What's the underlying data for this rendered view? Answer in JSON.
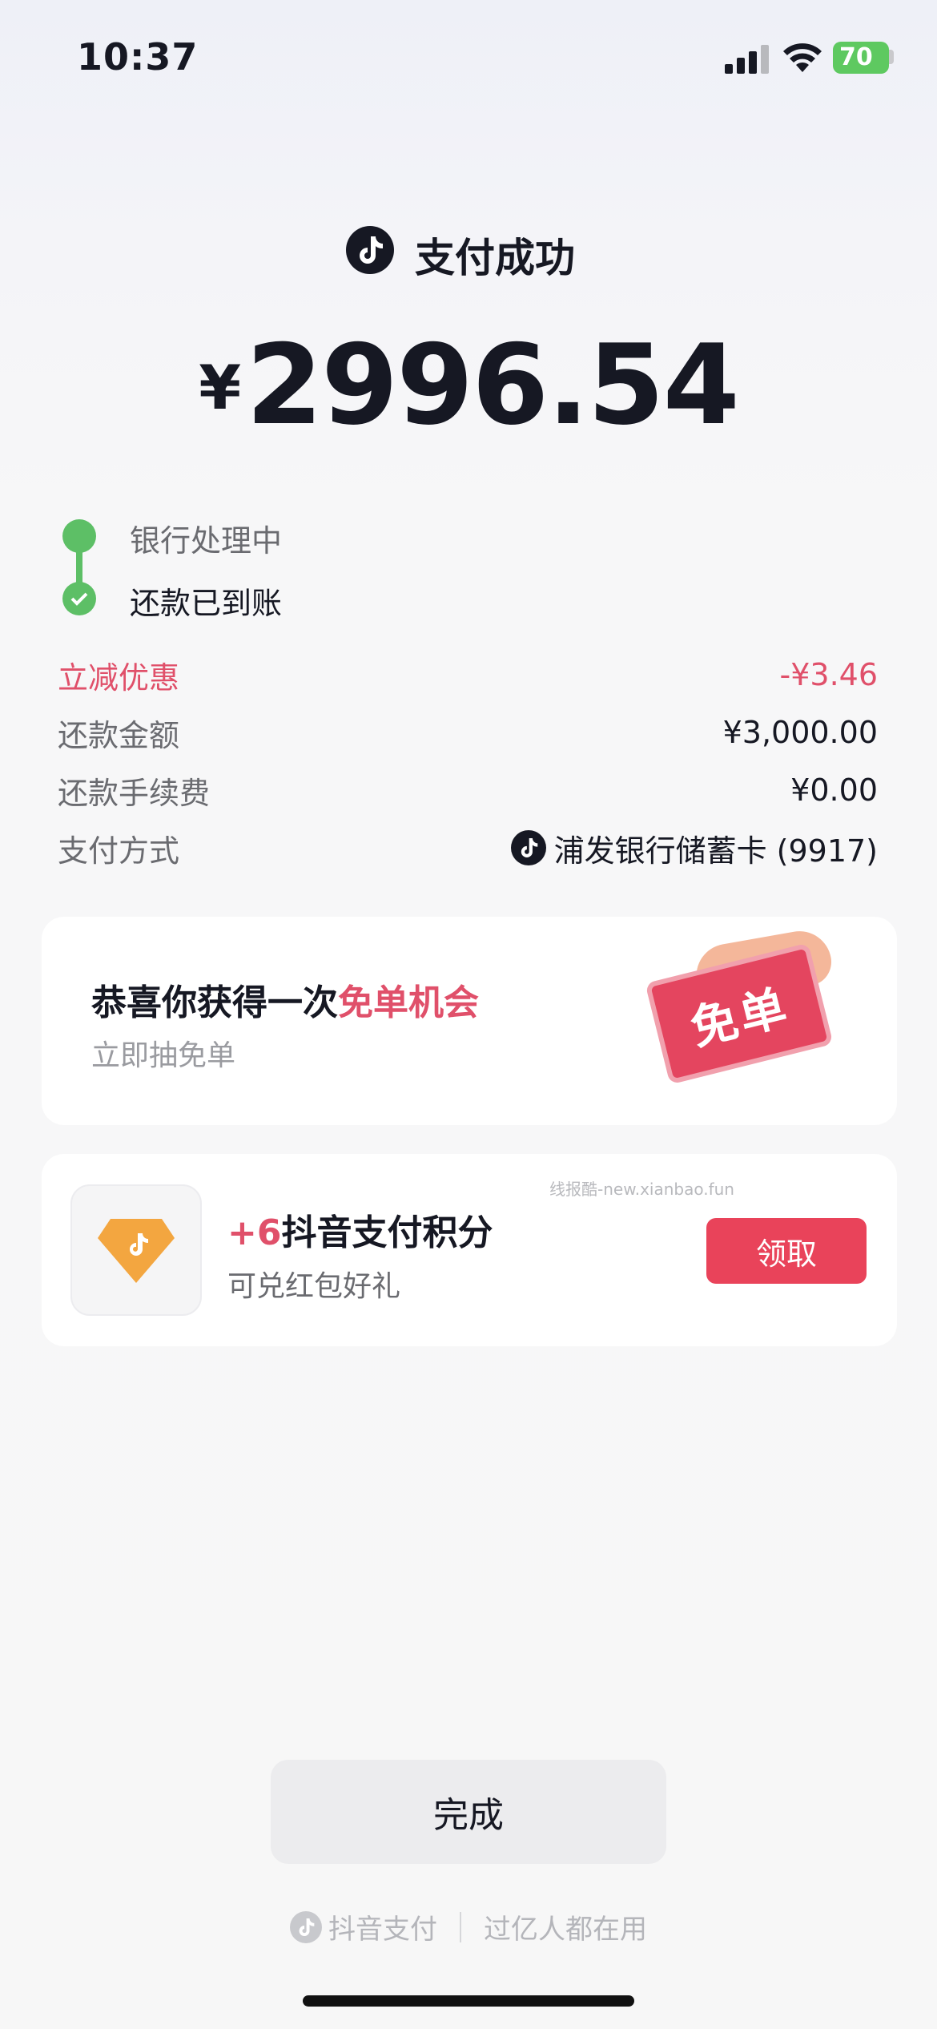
{
  "status_bar": {
    "time": "10:37",
    "battery": "70"
  },
  "header": {
    "title": "支付成功",
    "currency": "¥",
    "amount": "2996.54"
  },
  "progress": {
    "steps": [
      "银行处理中",
      "还款已到账"
    ]
  },
  "details": [
    {
      "label": "立减优惠",
      "value": "-¥3.46",
      "highlight": true
    },
    {
      "label": "还款金额",
      "value": "¥3,000.00"
    },
    {
      "label": "还款手续费",
      "value": "¥0.00"
    },
    {
      "label": "支付方式",
      "value": "浦发银行储蓄卡 (9917)"
    }
  ],
  "free_card": {
    "title_prefix": "恭喜你获得一次",
    "title_highlight": "免单机会",
    "subtitle": "立即抽免单",
    "coupon_text": "免单"
  },
  "points_card": {
    "points": "+6",
    "title": "抖音支付积分",
    "subtitle": "可兑红包好礼",
    "button": "领取",
    "watermark": "线报酷-new.xianbao.fun"
  },
  "done_button": "完成",
  "footer": {
    "brand": "抖音支付",
    "slogan": "过亿人都在用"
  },
  "colors": {
    "accent": "#e0506a",
    "success": "#5dbf66",
    "button_red": "#e9435a"
  }
}
